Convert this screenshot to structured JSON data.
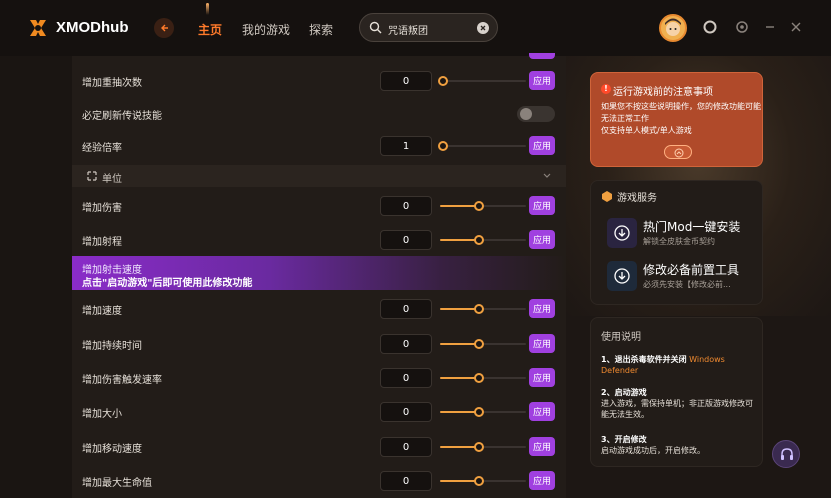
{
  "app": {
    "brand": "XMODhub"
  },
  "nav": {
    "home": "主页",
    "my_games": "我的游戏",
    "explore": "探索"
  },
  "search": {
    "value": "咒语叛团"
  },
  "rows_top": [
    {
      "label": "增加重抽次数",
      "value": "0",
      "apply": "应用",
      "level": 0
    },
    {
      "label": "必定刷新传说技能",
      "type": "toggle"
    },
    {
      "label": "经验倍率",
      "value": "1",
      "apply": "应用",
      "level": 0
    }
  ],
  "section": {
    "label": "单位"
  },
  "rows_unit": [
    {
      "label": "增加伤害",
      "value": "0",
      "apply": "应用",
      "level": 0.45
    },
    {
      "label": "增加射程",
      "value": "0",
      "apply": "应用",
      "level": 0.45
    }
  ],
  "banner": {
    "row_label": "增加射击速度",
    "message": "点击\"启动游戏\"后即可使用此修改功能"
  },
  "rows_bottom": [
    {
      "label": "增加速度",
      "value": "0",
      "apply": "应用",
      "level": 0.45
    },
    {
      "label": "增加持续时间",
      "value": "0",
      "apply": "应用",
      "level": 0.45
    },
    {
      "label": "增加伤害触发速率",
      "value": "0",
      "apply": "应用",
      "level": 0.45
    },
    {
      "label": "增加大小",
      "value": "0",
      "apply": "应用",
      "level": 0.45
    },
    {
      "label": "增加移动速度",
      "value": "0",
      "apply": "应用",
      "level": 0.45
    },
    {
      "label": "增加最大生命值",
      "value": "0",
      "apply": "应用",
      "level": 0.45
    }
  ],
  "notice": {
    "title": "运行游戏前的注意事项",
    "line1": "如果您不按这些说明操作，您的修改功能可能无法正常工作",
    "line2": "仅支持单人模式/单人游戏"
  },
  "services": {
    "title": "游戏服务",
    "items": [
      {
        "name": "热门Mod一键安装",
        "sub": "解锁全皮肤金币契约"
      },
      {
        "name": "修改必备前置工具",
        "sub": "必须先安装【修改必前..."
      }
    ]
  },
  "usage": {
    "title": "使用说明",
    "step1_title": "1、退出杀毒软件并关闭",
    "step1_highlight": "Windows Defender",
    "step2_title": "2、启动游戏",
    "step2_body": "进入游戏，需保持单机；非正版游戏修改可能无法生效。",
    "step3_title": "3、开启修改",
    "step3_body": "启动游戏成功后，开启修改。"
  },
  "colors": {
    "accent": "#ff7a2a",
    "apply": "#a040e0",
    "slider": "#f0a040",
    "notice": "#b04a2a"
  }
}
